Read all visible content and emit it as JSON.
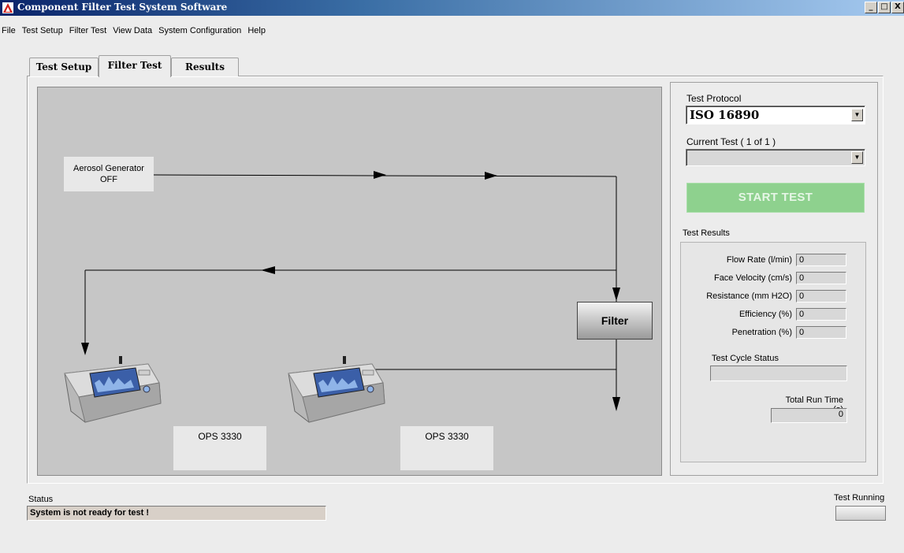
{
  "window": {
    "title": "Component Filter Test System Software",
    "buttons": {
      "minimize": "_",
      "maximize": "□",
      "close": "X"
    }
  },
  "menu": [
    "File",
    "Test Setup",
    "Filter Test",
    "View Data",
    "System Configuration",
    "Help"
  ],
  "tabs": [
    {
      "label": "Test Setup",
      "active": false
    },
    {
      "label": "Filter Test",
      "active": true
    },
    {
      "label": "Results",
      "active": false
    }
  ],
  "diagram": {
    "generator": {
      "name": "Aerosol Generator",
      "state": "OFF"
    },
    "filter_label": "Filter",
    "devices": [
      {
        "label": "OPS 3330"
      },
      {
        "label": "OPS 3330"
      }
    ]
  },
  "controls": {
    "protocol_label": "Test Protocol",
    "protocol_value": "ISO 16890",
    "current_test_label": "Current Test ( 1 of 1 )",
    "current_test_value": "",
    "start_button": "START TEST"
  },
  "results": {
    "section_label": "Test Results",
    "fields": [
      {
        "label": "Flow Rate (l/min)",
        "value": "0"
      },
      {
        "label": "Face Velocity (cm/s)",
        "value": "0"
      },
      {
        "label": "Resistance (mm H2O)",
        "value": "0"
      },
      {
        "label": "Efficiency (%)",
        "value": "0"
      },
      {
        "label": "Penetration (%)",
        "value": "0"
      }
    ],
    "cycle_status_label": "Test Cycle Status",
    "cycle_status_value": "",
    "run_time_label": "Total Run Time (s)",
    "run_time_value": "0"
  },
  "status": {
    "label": "Status",
    "message": "System is not ready for test !",
    "running_label": "Test Running"
  },
  "colors": {
    "title_bar": "#0a246a",
    "start_button": "#8ed18e",
    "diagram_bg": "#c6c6c6"
  }
}
